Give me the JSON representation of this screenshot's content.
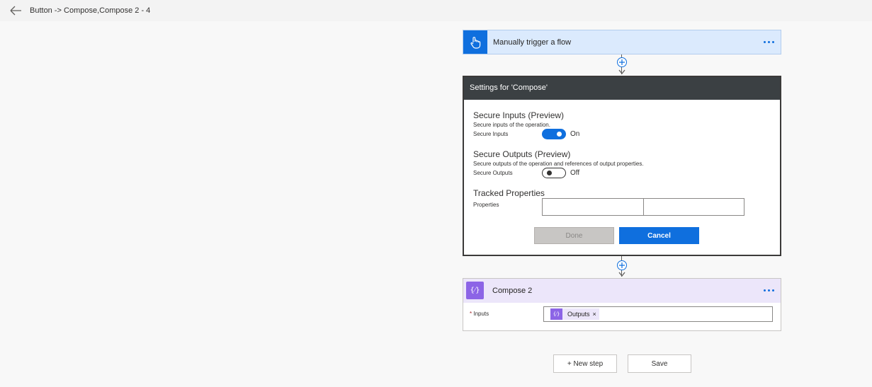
{
  "header": {
    "title": "Button -> Compose,Compose 2 - 4"
  },
  "trigger": {
    "title": "Manually trigger a flow"
  },
  "settings": {
    "title": "Settings for 'Compose'",
    "secure_inputs": {
      "title": "Secure Inputs (Preview)",
      "description": "Secure inputs of the operation.",
      "label": "Secure Inputs",
      "state": "On"
    },
    "secure_outputs": {
      "title": "Secure Outputs (Preview)",
      "description": "Secure outputs of the operation and references of output properties.",
      "label": "Secure Outputs",
      "state": "Off"
    },
    "tracked_properties": {
      "title": "Tracked Properties",
      "label": "Properties",
      "key_value": "",
      "value_value": ""
    },
    "done_label": "Done",
    "cancel_label": "Cancel"
  },
  "compose2": {
    "title": "Compose 2",
    "inputs_required_mark": "*",
    "inputs_label": "Inputs",
    "token_label": "Outputs",
    "token_remove": "×"
  },
  "footer": {
    "new_step_label": "+ New step",
    "save_label": "Save"
  },
  "colors": {
    "accent": "#0f6fde",
    "trigger_bg": "#dbeafd",
    "compose_accent": "#8c64e6",
    "compose_bg": "#ece6fa",
    "settings_header": "#3b4043"
  }
}
